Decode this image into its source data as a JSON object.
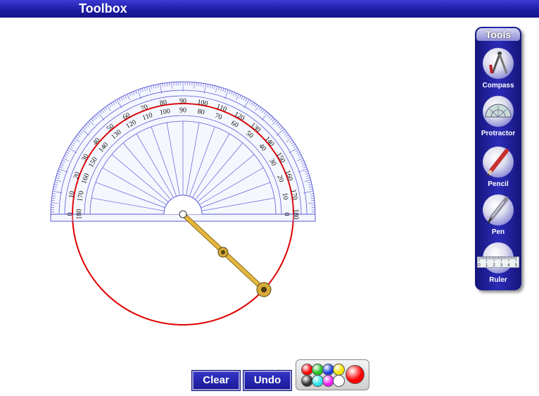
{
  "app": {
    "title": "Toolbox"
  },
  "tools_panel": {
    "header": "Tools",
    "items": [
      {
        "label": "Compass",
        "icon": "compass-icon"
      },
      {
        "label": "Protractor",
        "icon": "protractor-icon"
      },
      {
        "label": "Pencil",
        "icon": "pencil-icon"
      },
      {
        "label": "Pen",
        "icon": "pen-icon"
      },
      {
        "label": "Ruler",
        "icon": "ruler-icon"
      }
    ]
  },
  "protractor": {
    "outer_scale": [
      "0",
      "10",
      "20",
      "30",
      "40",
      "50",
      "60",
      "70",
      "80",
      "90",
      "100",
      "110",
      "120",
      "130",
      "140",
      "150",
      "160",
      "170",
      "180"
    ],
    "inner_scale": [
      "180",
      "170",
      "160",
      "150",
      "140",
      "130",
      "120",
      "110",
      "100",
      "90",
      "80",
      "70",
      "60",
      "50",
      "40",
      "30",
      "20",
      "10",
      "0"
    ]
  },
  "ruler_icon_ticks": [
    "0",
    "1",
    "2",
    "3",
    "4",
    "5"
  ],
  "actions": {
    "clear_label": "Clear",
    "undo_label": "Undo"
  },
  "palette": {
    "colors": [
      "#ff0000",
      "#22c222",
      "#1a3fe0",
      "#f2e200",
      "#333333",
      "#29e6f0",
      "#f020f0",
      "#ffffff"
    ],
    "selected": "#ff0000"
  },
  "drawing": {
    "circle_color": "#dd0000",
    "protractor_color": "#5a5ad6"
  }
}
